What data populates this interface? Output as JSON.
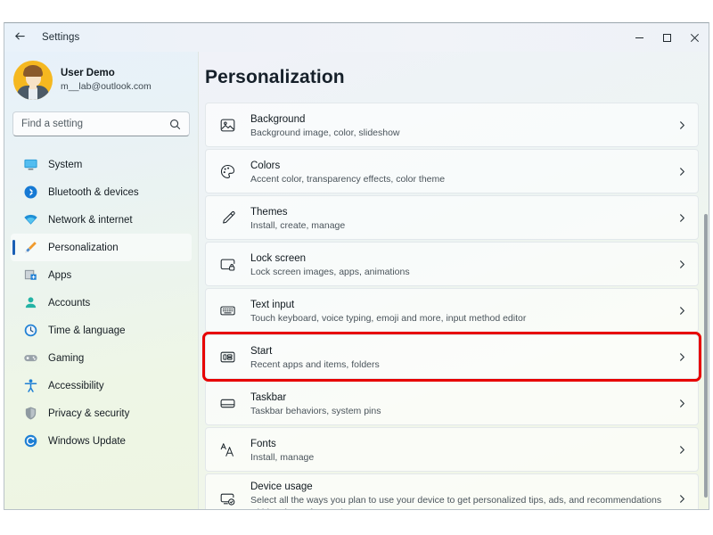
{
  "window": {
    "title": "Settings",
    "back_icon": "back-arrow-icon",
    "controls": {
      "minimize": "minimize-icon",
      "maximize": "maximize-icon",
      "close": "close-icon"
    }
  },
  "sidebar": {
    "profile": {
      "name": "User Demo",
      "email": "m__lab@outlook.com",
      "avatar_color": "#f5b820"
    },
    "search": {
      "placeholder": "Find a setting",
      "value": "",
      "icon": "search-icon"
    },
    "items": [
      {
        "label": "System",
        "icon": "monitor-icon",
        "selected": false
      },
      {
        "label": "Bluetooth & devices",
        "icon": "bluetooth-icon",
        "selected": false
      },
      {
        "label": "Network & internet",
        "icon": "wifi-icon",
        "selected": false
      },
      {
        "label": "Personalization",
        "icon": "paintbrush-icon",
        "selected": true
      },
      {
        "label": "Apps",
        "icon": "apps-icon",
        "selected": false
      },
      {
        "label": "Accounts",
        "icon": "account-icon",
        "selected": false
      },
      {
        "label": "Time & language",
        "icon": "clock-icon",
        "selected": false
      },
      {
        "label": "Gaming",
        "icon": "gamepad-icon",
        "selected": false
      },
      {
        "label": "Accessibility",
        "icon": "accessibility-icon",
        "selected": false
      },
      {
        "label": "Privacy & security",
        "icon": "shield-icon",
        "selected": false
      },
      {
        "label": "Windows Update",
        "icon": "update-icon",
        "selected": false
      }
    ],
    "accent_color": "#1b5fb5"
  },
  "main": {
    "page_title": "Personalization",
    "highlight_color": "#e70000",
    "rows": [
      {
        "title": "Background",
        "subtitle": "Background image, color, slideshow",
        "icon": "picture-icon",
        "chevron": "chevron-right-icon",
        "highlighted": false
      },
      {
        "title": "Colors",
        "subtitle": "Accent color, transparency effects, color theme",
        "icon": "palette-icon",
        "chevron": "chevron-right-icon",
        "highlighted": false
      },
      {
        "title": "Themes",
        "subtitle": "Install, create, manage",
        "icon": "paintbrush-icon",
        "chevron": "chevron-right-icon",
        "highlighted": false
      },
      {
        "title": "Lock screen",
        "subtitle": "Lock screen images, apps, animations",
        "icon": "lock-screen-icon",
        "chevron": "chevron-right-icon",
        "highlighted": false
      },
      {
        "title": "Text input",
        "subtitle": "Touch keyboard, voice typing, emoji and more, input method editor",
        "icon": "keyboard-icon",
        "chevron": "chevron-right-icon",
        "highlighted": false
      },
      {
        "title": "Start",
        "subtitle": "Recent apps and items, folders",
        "icon": "start-menu-icon",
        "chevron": "chevron-right-icon",
        "highlighted": true
      },
      {
        "title": "Taskbar",
        "subtitle": "Taskbar behaviors, system pins",
        "icon": "taskbar-icon",
        "chevron": "chevron-right-icon",
        "highlighted": false
      },
      {
        "title": "Fonts",
        "subtitle": "Install, manage",
        "icon": "fonts-icon",
        "chevron": "chevron-right-icon",
        "highlighted": false
      },
      {
        "title": "Device usage",
        "subtitle": "Select all the ways you plan to use your device to get personalized tips, ads, and recommendations within Microsoft experiences.",
        "icon": "device-usage-icon",
        "chevron": "chevron-right-icon",
        "highlighted": false
      }
    ]
  }
}
